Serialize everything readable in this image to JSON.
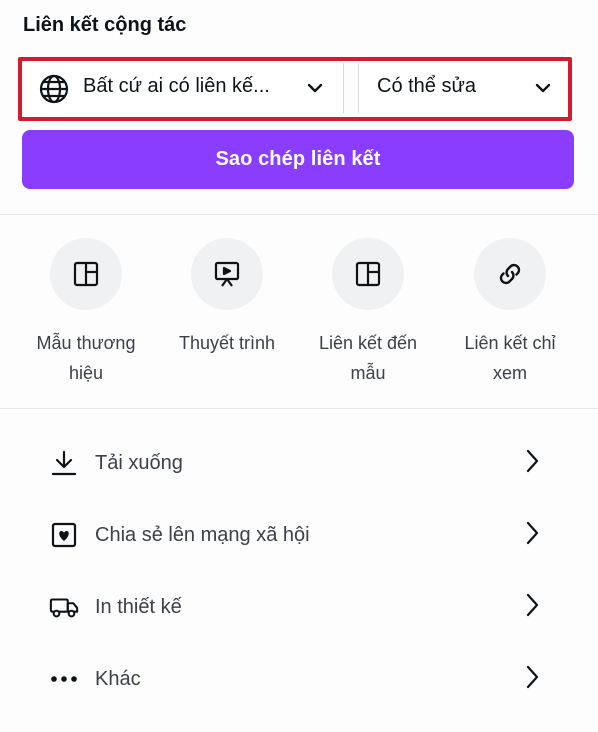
{
  "section_title": "Liên kết cộng tác",
  "access_select": {
    "value": "Bất cứ ai có liên kế...",
    "icon": "globe-icon"
  },
  "permission_select": {
    "value": "Có thể sửa"
  },
  "copy_button": {
    "label": "Sao chép liên kết"
  },
  "share_options": [
    {
      "label_line1": "Mẫu thương",
      "label_line2": "hiệu",
      "icon": "layout-template-icon"
    },
    {
      "label_line1": "Thuyết trình",
      "label_line2": "",
      "icon": "presentation-icon"
    },
    {
      "label_line1": "Liên kết đến",
      "label_line2": "mẫu",
      "icon": "layout-template-icon"
    },
    {
      "label_line1": "Liên kết chỉ",
      "label_line2": "xem",
      "icon": "link-icon"
    }
  ],
  "actions": [
    {
      "label": "Tải xuống",
      "icon": "download-icon"
    },
    {
      "label": "Chia sẻ lên mạng xã hội",
      "icon": "heart-frame-icon"
    },
    {
      "label": "In thiết kế",
      "icon": "truck-icon"
    },
    {
      "label": "Khác",
      "icon": "more-dots-icon"
    }
  ],
  "colors": {
    "accent": "#8b3dff",
    "highlight_border": "#d21b2c"
  }
}
